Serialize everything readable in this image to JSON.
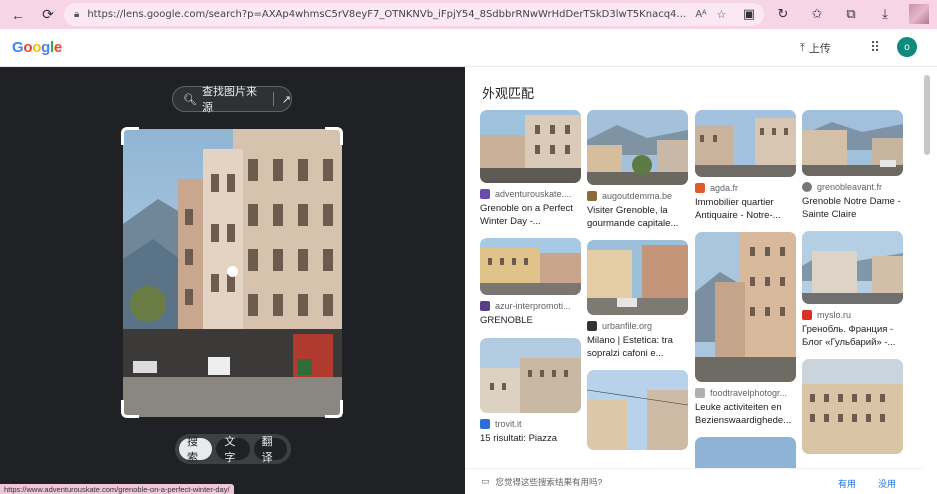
{
  "browser": {
    "url": "https://lens.google.com/search?p=AXAp4whmsC5rV8eyF7_OTNKNVb_iFpjY54_8SdbbrRNwWrHdDerTSkD3lwT5Knacq4LcBHZtKgTC_4R2gqbK34OA3JBy-k4F0...",
    "read_aloud": "Aᴬ"
  },
  "header": {
    "logo_letters": [
      "G",
      "o",
      "o",
      "g",
      "l",
      "e"
    ],
    "upload_label": "上传",
    "avatar_initial": "o"
  },
  "left": {
    "find_source_label": "查找图片来源",
    "tabs": [
      "搜索",
      "文字",
      "翻译"
    ],
    "active_tab": "搜索",
    "status_url": "https://www.adventurouskate.com/grenoble-on-a-perfect-winter-day/"
  },
  "results": {
    "section_title": "外观匹配",
    "columns": [
      [
        {
          "site": "adventurouskate....",
          "title": "Grenoble on a Perfect Winter Day -...",
          "fav_color": "#6a4bb0"
        },
        {
          "site": "azur-interpromoti...",
          "title": "GRENOBLE",
          "fav_color": "#5a3d8a"
        },
        {
          "site": "trovit.it",
          "title": "15 risultati: Piazza",
          "fav_color": "#2b6fd6"
        }
      ],
      [
        {
          "site": "augoutdemma.be",
          "title": "Visiter Grenoble, la gourmande capitale...",
          "fav_color": "#8a6b3a"
        },
        {
          "site": "urbanfile.org",
          "title": "Milano | Estetica: tra sopralzi cafoni e...",
          "fav_color": "#333333"
        }
      ],
      [
        {
          "site": "agda.fr",
          "title": "Immobilier quartier Antiquaire - Notre-...",
          "fav_color": "#e05a2b"
        },
        {
          "site": "foodtravelphotogr...",
          "title": "Leuke activiteiten en Bezienswaardighede...",
          "fav_color": "#b0b0b0"
        }
      ],
      [
        {
          "site": "grenobleavant.fr",
          "title": "Grenoble Notre Dame - Sainte Claire",
          "fav_color": "#777777"
        },
        {
          "site": "myslo.ru",
          "title": "Гренобль. Франция - Блог «Гульбарий» -...",
          "fav_color": "#d93025"
        }
      ]
    ],
    "feedback_question": "您觉得这些搜索结果有用吗?",
    "feedback_yes": "有用",
    "feedback_no": "没用"
  }
}
